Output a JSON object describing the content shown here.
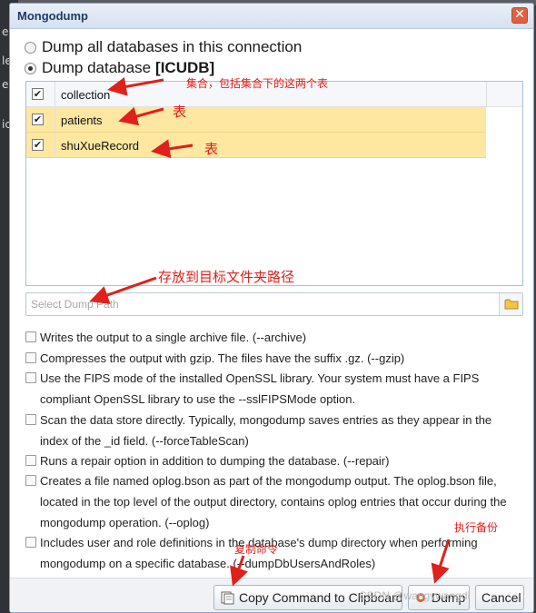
{
  "background": {
    "chars": [
      "ec",
      "le",
      "e",
      "ic"
    ]
  },
  "dialog": {
    "title": "Mongodump",
    "close_glyph": "✕",
    "radio_all_label": "Dump all databases in this connection",
    "radio_db_label": "Dump database",
    "database_name": "[ICUDB]",
    "selected_radio": "database"
  },
  "collections": {
    "rows": [
      {
        "name": "collection",
        "checked": true,
        "highlighted": false
      },
      {
        "name": "patients",
        "checked": true,
        "highlighted": true
      },
      {
        "name": "shuXueRecord",
        "checked": true,
        "highlighted": true
      }
    ],
    "checkmark": "✔"
  },
  "path": {
    "placeholder": "Select Dump Path",
    "value": "",
    "browse_icon": "folder-icon"
  },
  "options": [
    {
      "text": "Writes the output to a single archive file. (--archive)",
      "checked": false
    },
    {
      "text": "Compresses the output with gzip. The files have the suffix .gz. (--gzip)",
      "checked": false
    },
    {
      "text": "Use the FIPS mode of the installed OpenSSL library. Your system must have a FIPS compliant OpenSSL library to use the --sslFIPSMode option.",
      "checked": false
    },
    {
      "text": "Scan the data store directly. Typically, mongodump saves entries as they appear in the index of the _id field. (--forceTableScan)",
      "checked": false
    },
    {
      "text": "Runs a repair option in addition to dumping the database. (--repair)",
      "checked": false
    },
    {
      "text": "Creates a file named oplog.bson as part of the mongodump output. The oplog.bson file, located in the top level of the output directory, contains oplog entries that occur during the mongodump operation. (--oplog)",
      "checked": false
    },
    {
      "text": "Includes user and role definitions in the database's dump directory when performing mongodump on a specific database. (--dumpDbUsersAndRoles)",
      "checked": false
    }
  ],
  "buttons": {
    "copy_command": "Copy Command to Clipboard",
    "dump": "Dump",
    "cancel": "Cancel"
  },
  "annotations": {
    "collection_note": "集合，包括集合下的这两个表",
    "patients_note": "表",
    "shuxue_note": "表",
    "path_note": "存放到目标文件夹路径",
    "copy_note": "复制命令",
    "dump_note": "执行备份",
    "color": "#e0201b"
  },
  "watermark": "CSDN @wangywangdi"
}
